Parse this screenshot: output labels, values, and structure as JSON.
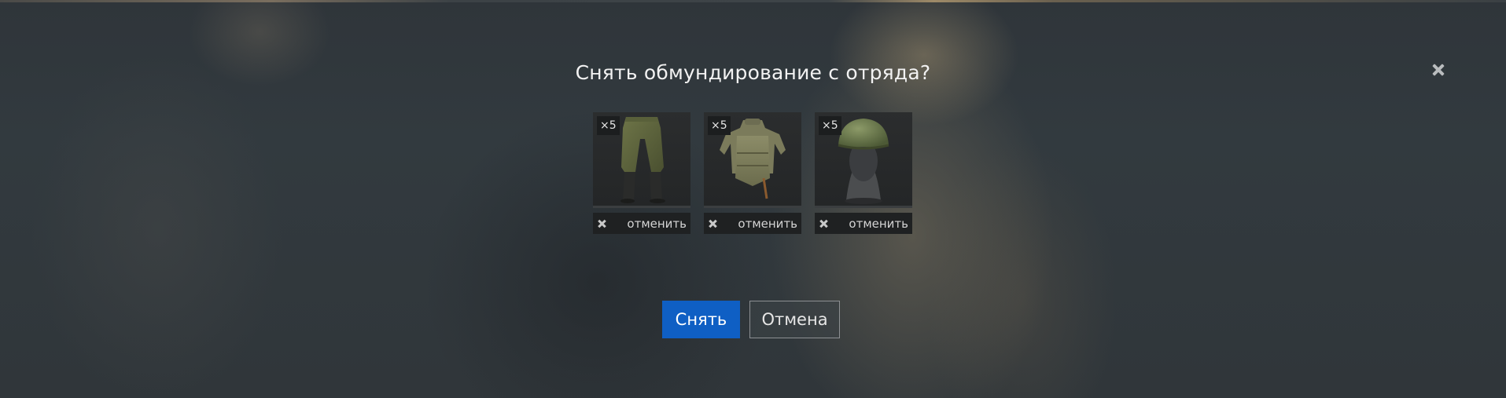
{
  "dialog": {
    "title": "Снять обмундирование с отряда?",
    "close_icon": "close-icon"
  },
  "items": [
    {
      "name": "trousers",
      "count": "×5",
      "cancel_label": "отменить",
      "icon": "trousers-icon"
    },
    {
      "name": "body-armor",
      "count": "×5",
      "cancel_label": "отменить",
      "icon": "body-armor-icon"
    },
    {
      "name": "helmet",
      "count": "×5",
      "cancel_label": "отменить",
      "icon": "helmet-icon"
    }
  ],
  "actions": {
    "confirm_label": "Снять",
    "cancel_label": "Отмена"
  },
  "colors": {
    "primary_button": "#0f5fc4",
    "background": "#32393e"
  }
}
